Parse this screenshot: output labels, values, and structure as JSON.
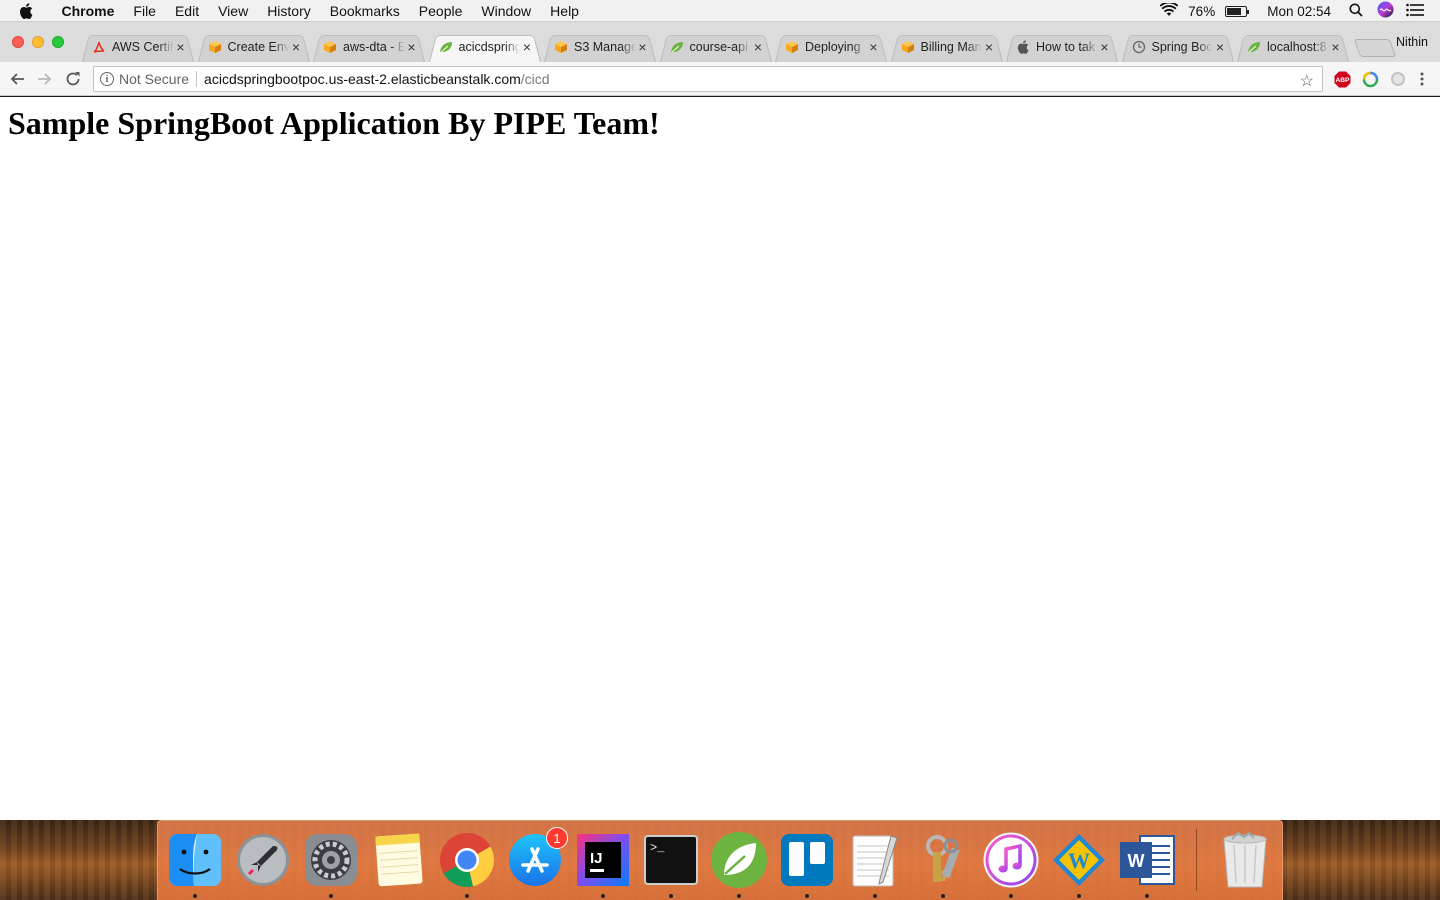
{
  "menubar": {
    "app_name": "Chrome",
    "items": [
      "File",
      "Edit",
      "View",
      "History",
      "Bookmarks",
      "People",
      "Window",
      "Help"
    ],
    "battery_percent": "76%",
    "battery_level": 0.76,
    "clock": "Mon 02:54"
  },
  "browser": {
    "profile_name": "Nithin",
    "tabs": [
      {
        "title": "AWS Certif",
        "icon": "acrobat-icon",
        "active": false
      },
      {
        "title": "Create Env",
        "icon": "aws-cube-icon",
        "active": false
      },
      {
        "title": "aws-dta - E",
        "icon": "aws-cube-icon",
        "active": false
      },
      {
        "title": "acicdspring",
        "icon": "spring-leaf-icon",
        "active": true
      },
      {
        "title": "S3 Manage",
        "icon": "aws-cube-icon",
        "active": false
      },
      {
        "title": "course-api",
        "icon": "spring-leaf-icon",
        "active": false
      },
      {
        "title": "Deploying",
        "icon": "aws-cube-icon",
        "active": false
      },
      {
        "title": "Billing Man",
        "icon": "aws-cube-icon",
        "active": false
      },
      {
        "title": "How to tak",
        "icon": "apple-icon",
        "active": false
      },
      {
        "title": "Spring Boo",
        "icon": "globe-icon",
        "active": false
      },
      {
        "title": "localhost:8",
        "icon": "spring-leaf-icon",
        "active": false
      }
    ],
    "address": {
      "security_label": "Not Secure",
      "host": "acicdspringbootpoc.us-east-2.elasticbeanstalk.com",
      "path": "/cicd"
    }
  },
  "page": {
    "heading": "Sample SpringBoot Application By PIPE Team!"
  },
  "dock": {
    "apps": [
      {
        "name": "finder-icon",
        "running": true
      },
      {
        "name": "launchpad-icon",
        "running": false
      },
      {
        "name": "system-preferences-icon",
        "running": true
      },
      {
        "name": "notes-icon",
        "running": false
      },
      {
        "name": "chrome-icon",
        "running": true
      },
      {
        "name": "app-store-icon",
        "running": false,
        "badge": "1"
      },
      {
        "name": "intellij-icon",
        "running": true
      },
      {
        "name": "terminal-icon",
        "running": true
      },
      {
        "name": "spring-tool-suite-icon",
        "running": true
      },
      {
        "name": "trello-icon",
        "running": true
      },
      {
        "name": "textedit-icon",
        "running": true
      },
      {
        "name": "keychain-icon",
        "running": true
      },
      {
        "name": "itunes-icon",
        "running": true
      },
      {
        "name": "aws-workdocs-icon",
        "running": true
      },
      {
        "name": "word-icon",
        "running": true
      },
      {
        "name": "trash-icon",
        "running": false
      }
    ]
  }
}
